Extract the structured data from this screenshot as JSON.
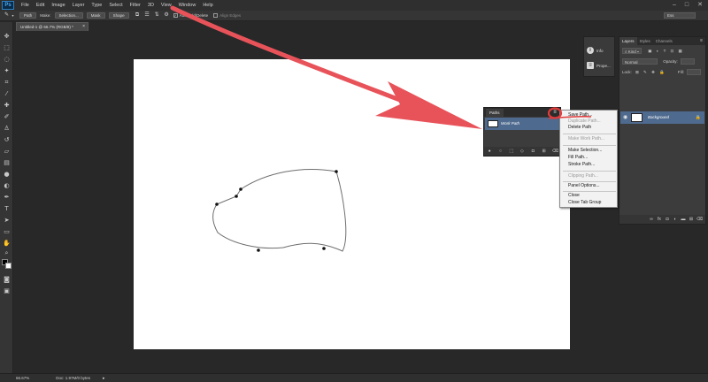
{
  "app": {
    "logo": "Ps",
    "menu": [
      "File",
      "Edit",
      "Image",
      "Layer",
      "Type",
      "Select",
      "Filter",
      "3D",
      "View",
      "Window",
      "Help"
    ],
    "window_controls": [
      "–",
      "□",
      "✕"
    ]
  },
  "options_bar": {
    "mode": "Path",
    "make_label": "Make:",
    "selection_button": "Selection...",
    "mask_button": "Mask",
    "shape_button": "Shape",
    "auto_add_delete": "Auto Add/Delete",
    "auto_add_delete_checked": true,
    "align_edges": "Align Edges",
    "workspace": "Ess"
  },
  "document": {
    "tab_title": "Untitled-1 @ 66.7% (RGB/8) *",
    "zoom": "66.67%",
    "doc_size": "Doc: 1.97M/0 bytes"
  },
  "mini_panels": [
    {
      "icon": "info-icon",
      "label": "Info"
    },
    {
      "icon": "properties-icon",
      "label": "Prope..."
    }
  ],
  "layers_panel": {
    "tabs": [
      "Layers",
      "Styles",
      "Channels"
    ],
    "active_tab": "Layers",
    "filter_kind": "Kind",
    "blend_mode": "Normal",
    "opacity_label": "Opacity:",
    "lock_label": "Lock:",
    "fill_label": "Fill:",
    "layers": [
      {
        "name": "Background",
        "locked": true,
        "visible": true
      }
    ]
  },
  "paths_panel": {
    "tab": "Paths",
    "paths": [
      {
        "name": "Work Path"
      }
    ]
  },
  "flyout_menu": {
    "items": [
      {
        "label": "Save Path...",
        "enabled": true,
        "highlighted": true
      },
      {
        "label": "Duplicate Path...",
        "enabled": false
      },
      {
        "label": "Delete Path",
        "enabled": true
      },
      {
        "separator": true
      },
      {
        "label": "Make Work Path...",
        "enabled": false
      },
      {
        "separator": true
      },
      {
        "label": "Make Selection...",
        "enabled": true
      },
      {
        "label": "Fill Path...",
        "enabled": true
      },
      {
        "label": "Stroke Path...",
        "enabled": true
      },
      {
        "separator": true
      },
      {
        "label": "Clipping Path...",
        "enabled": false
      },
      {
        "separator": true
      },
      {
        "label": "Panel Options...",
        "enabled": true
      },
      {
        "separator": true
      },
      {
        "label": "Close",
        "enabled": true
      },
      {
        "label": "Close Tab Group",
        "enabled": true
      }
    ]
  },
  "annotation": {
    "arrow_color": "#e8535a",
    "circle_color": "#e23b3b"
  }
}
